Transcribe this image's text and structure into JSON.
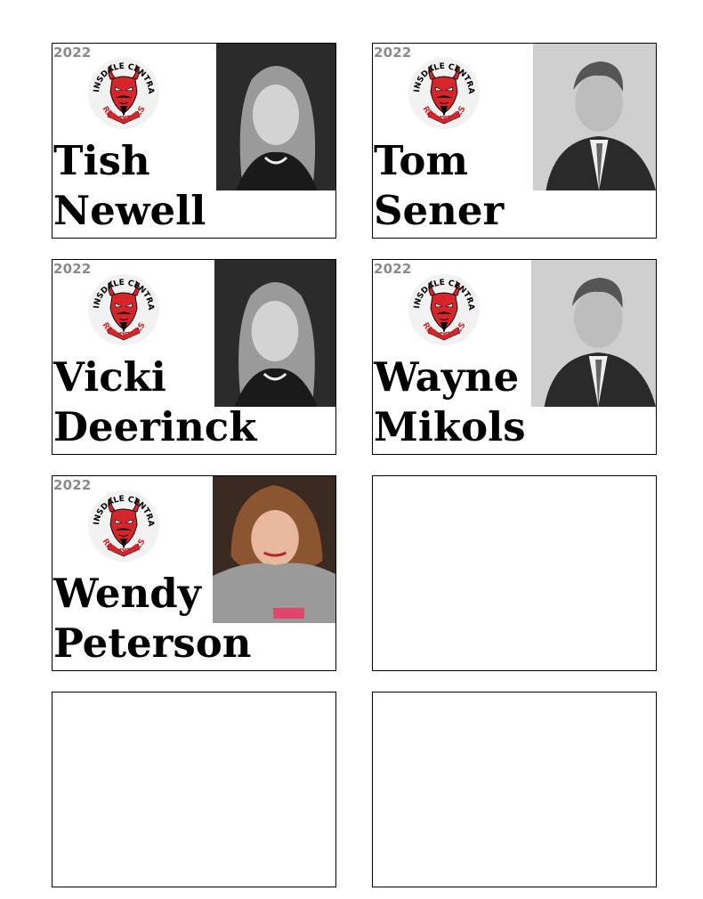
{
  "cards": [
    {
      "year": "2022",
      "logo_top": "HINSDALE CENTRAL",
      "logo_bottom": "RED DEVILS",
      "first": "Tish",
      "last": "Newell",
      "photo": "yearbook-portrait-female"
    },
    {
      "year": "2022",
      "logo_top": "HINSDALE CENTRAL",
      "logo_bottom": "RED DEVILS",
      "first": "Tom",
      "last": "Sener",
      "photo": "yearbook-portrait-male"
    },
    {
      "year": "2022",
      "logo_top": "HINSDALE CENTRAL",
      "logo_bottom": "RED DEVILS",
      "first": "Vicki",
      "last": "Deerinck",
      "photo": "yearbook-portrait-female"
    },
    {
      "year": "2022",
      "logo_top": "HINSDALE CENTRAL",
      "logo_bottom": "RED DEVILS",
      "first": "Wayne",
      "last": "Mikols",
      "photo": "yearbook-portrait-male"
    },
    {
      "year": "2022",
      "logo_top": "HINSDALE CENTRAL",
      "logo_bottom": "RED DEVILS",
      "first": "Wendy",
      "last": "Peterson",
      "photo": "color-reunion-photo"
    }
  ],
  "colors": {
    "logo_red": "#d7262b",
    "year_gray": "#8a8a8a",
    "border": "#000000"
  }
}
